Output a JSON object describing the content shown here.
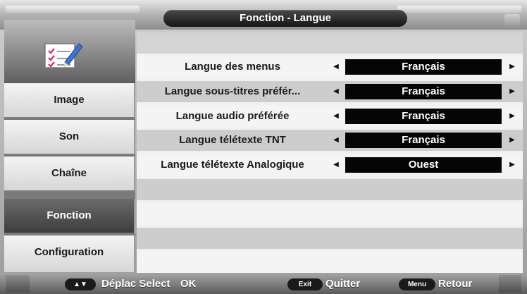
{
  "header": {
    "title": "Fonction - Langue"
  },
  "sidebar": {
    "icon": "checklist-pencil-icon",
    "tabs": [
      {
        "label": "Image",
        "active": false
      },
      {
        "label": "Son",
        "active": false
      },
      {
        "label": "Chaîne",
        "active": false
      },
      {
        "label": "Fonction",
        "active": true
      },
      {
        "label": "Configuration",
        "active": false
      }
    ]
  },
  "main": {
    "rows": [
      {
        "label": "Langue des menus",
        "value": "Français"
      },
      {
        "label": "Langue sous-titres préfér...",
        "value": "Français"
      },
      {
        "label": "Langue audio préférée",
        "value": "Français"
      },
      {
        "label": "Langue télétexte TNT",
        "value": "Français"
      },
      {
        "label": "Langue télétexte Analogique",
        "value": "Ouest"
      }
    ]
  },
  "footer": {
    "nav_key": "▲▼",
    "nav_text": "Déplac Select",
    "ok_text": "OK",
    "exit_key": "Exit",
    "exit_text": "Quitter",
    "menu_key": "Menu",
    "menu_text": "Retour"
  },
  "colors": {
    "value_bg": "#050505",
    "active_tab": "#4a4a4a",
    "title_bar": "#1e1e1e"
  }
}
